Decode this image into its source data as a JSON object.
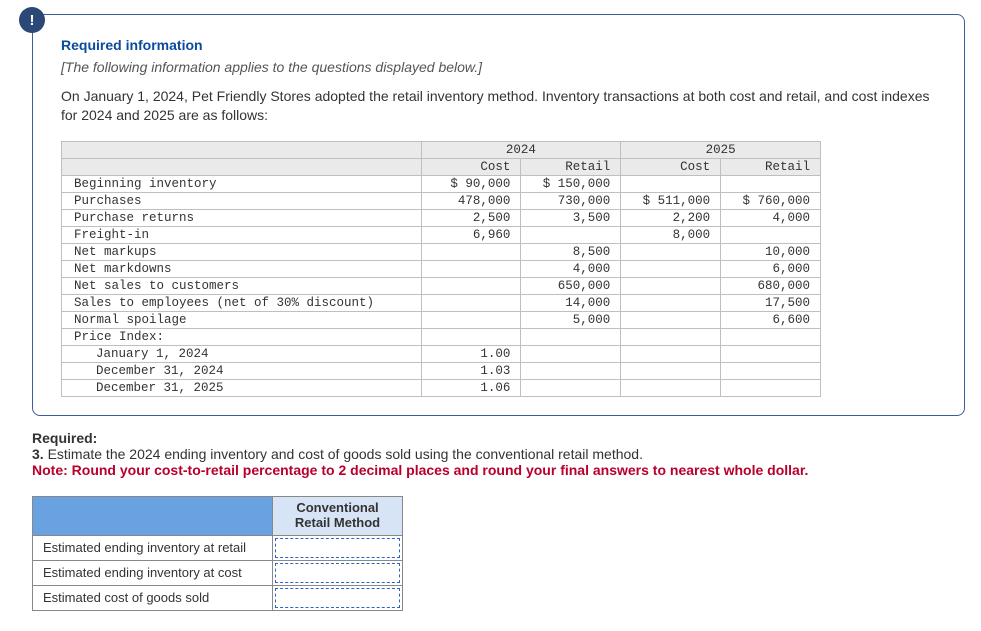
{
  "panel": {
    "badge": "!",
    "heading": "Required information",
    "applies_note": "[The following information applies to the questions displayed below.]",
    "intro": "On January 1, 2024, Pet Friendly Stores adopted the retail inventory method. Inventory transactions at both cost and retail, and cost indexes for 2024 and 2025 are as follows:"
  },
  "table": {
    "year1": "2024",
    "year2": "2025",
    "col_cost": "Cost",
    "col_retail": "Retail",
    "rows": {
      "beginning_inventory": {
        "label": "Beginning inventory",
        "c24": "$ 90,000",
        "r24": "$ 150,000",
        "c25": "",
        "r25": ""
      },
      "purchases": {
        "label": "Purchases",
        "c24": "478,000",
        "r24": "730,000",
        "c25": "$ 511,000",
        "r25": "$ 760,000"
      },
      "purchase_returns": {
        "label": "Purchase returns",
        "c24": "2,500",
        "r24": "3,500",
        "c25": "2,200",
        "r25": "4,000"
      },
      "freight_in": {
        "label": "Freight-in",
        "c24": "6,960",
        "r24": "",
        "c25": "8,000",
        "r25": ""
      },
      "net_markups": {
        "label": "Net markups",
        "c24": "",
        "r24": "8,500",
        "c25": "",
        "r25": "10,000"
      },
      "net_markdowns": {
        "label": "Net markdowns",
        "c24": "",
        "r24": "4,000",
        "c25": "",
        "r25": "6,000"
      },
      "net_sales": {
        "label": "Net sales to customers",
        "c24": "",
        "r24": "650,000",
        "c25": "",
        "r25": "680,000"
      },
      "emp_sales": {
        "label": "Sales to employees (net of 30% discount)",
        "c24": "",
        "r24": "14,000",
        "c25": "",
        "r25": "17,500"
      },
      "spoilage": {
        "label": "Normal spoilage",
        "c24": "",
        "r24": "5,000",
        "c25": "",
        "r25": "6,600"
      },
      "price_index": {
        "label": "Price Index:"
      },
      "pi_jan": {
        "label": "January 1, 2024",
        "c24": "1.00"
      },
      "pi_dec24": {
        "label": "December 31, 2024",
        "c24": "1.03"
      },
      "pi_dec25": {
        "label": "December 31, 2025",
        "c24": "1.06"
      }
    }
  },
  "required": {
    "label": "Required:",
    "item_no": "3.",
    "item_text": " Estimate the 2024 ending inventory and cost of goods sold using the conventional retail method.",
    "note": "Note: Round your cost-to-retail percentage to 2 decimal places and round your final answers to nearest whole dollar."
  },
  "answer": {
    "col_head_l1": "Conventional",
    "col_head_l2": "Retail Method",
    "rows": {
      "r1": "Estimated ending inventory at retail",
      "r2": "Estimated ending inventory at cost",
      "r3": "Estimated cost of goods sold"
    }
  }
}
